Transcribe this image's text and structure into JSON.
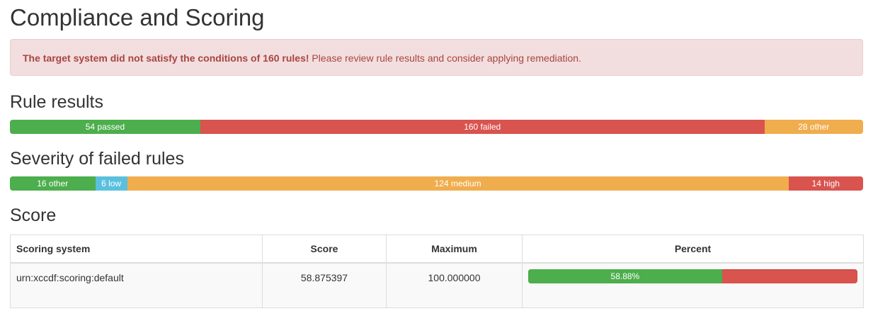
{
  "title": "Compliance and Scoring",
  "alert": {
    "bold": "The target system did not satisfy the conditions of 160 rules!",
    "text": " Please review rule results and consider applying remediation."
  },
  "rule_results": {
    "heading": "Rule results",
    "segments": [
      {
        "label": "54 passed",
        "count": 54,
        "color": "#4cae4c"
      },
      {
        "label": "160 failed",
        "count": 160,
        "color": "#d9534f"
      },
      {
        "label": "28 other",
        "count": 28,
        "color": "#f0ad4e"
      }
    ]
  },
  "severity": {
    "heading": "Severity of failed rules",
    "segments": [
      {
        "label": "16 other",
        "count": 16,
        "color": "#4cae4c"
      },
      {
        "label": "6 low",
        "count": 6,
        "color": "#5bc0de"
      },
      {
        "label": "124 medium",
        "count": 124,
        "color": "#f0ad4e"
      },
      {
        "label": "14 high",
        "count": 14,
        "color": "#d9534f"
      }
    ]
  },
  "score": {
    "heading": "Score",
    "columns": [
      "Scoring system",
      "Score",
      "Maximum",
      "Percent"
    ],
    "rows": [
      {
        "system": "urn:xccdf:scoring:default",
        "score": "58.875397",
        "maximum": "100.000000",
        "percent_label": "58.88%",
        "percent": 58.88
      }
    ]
  }
}
